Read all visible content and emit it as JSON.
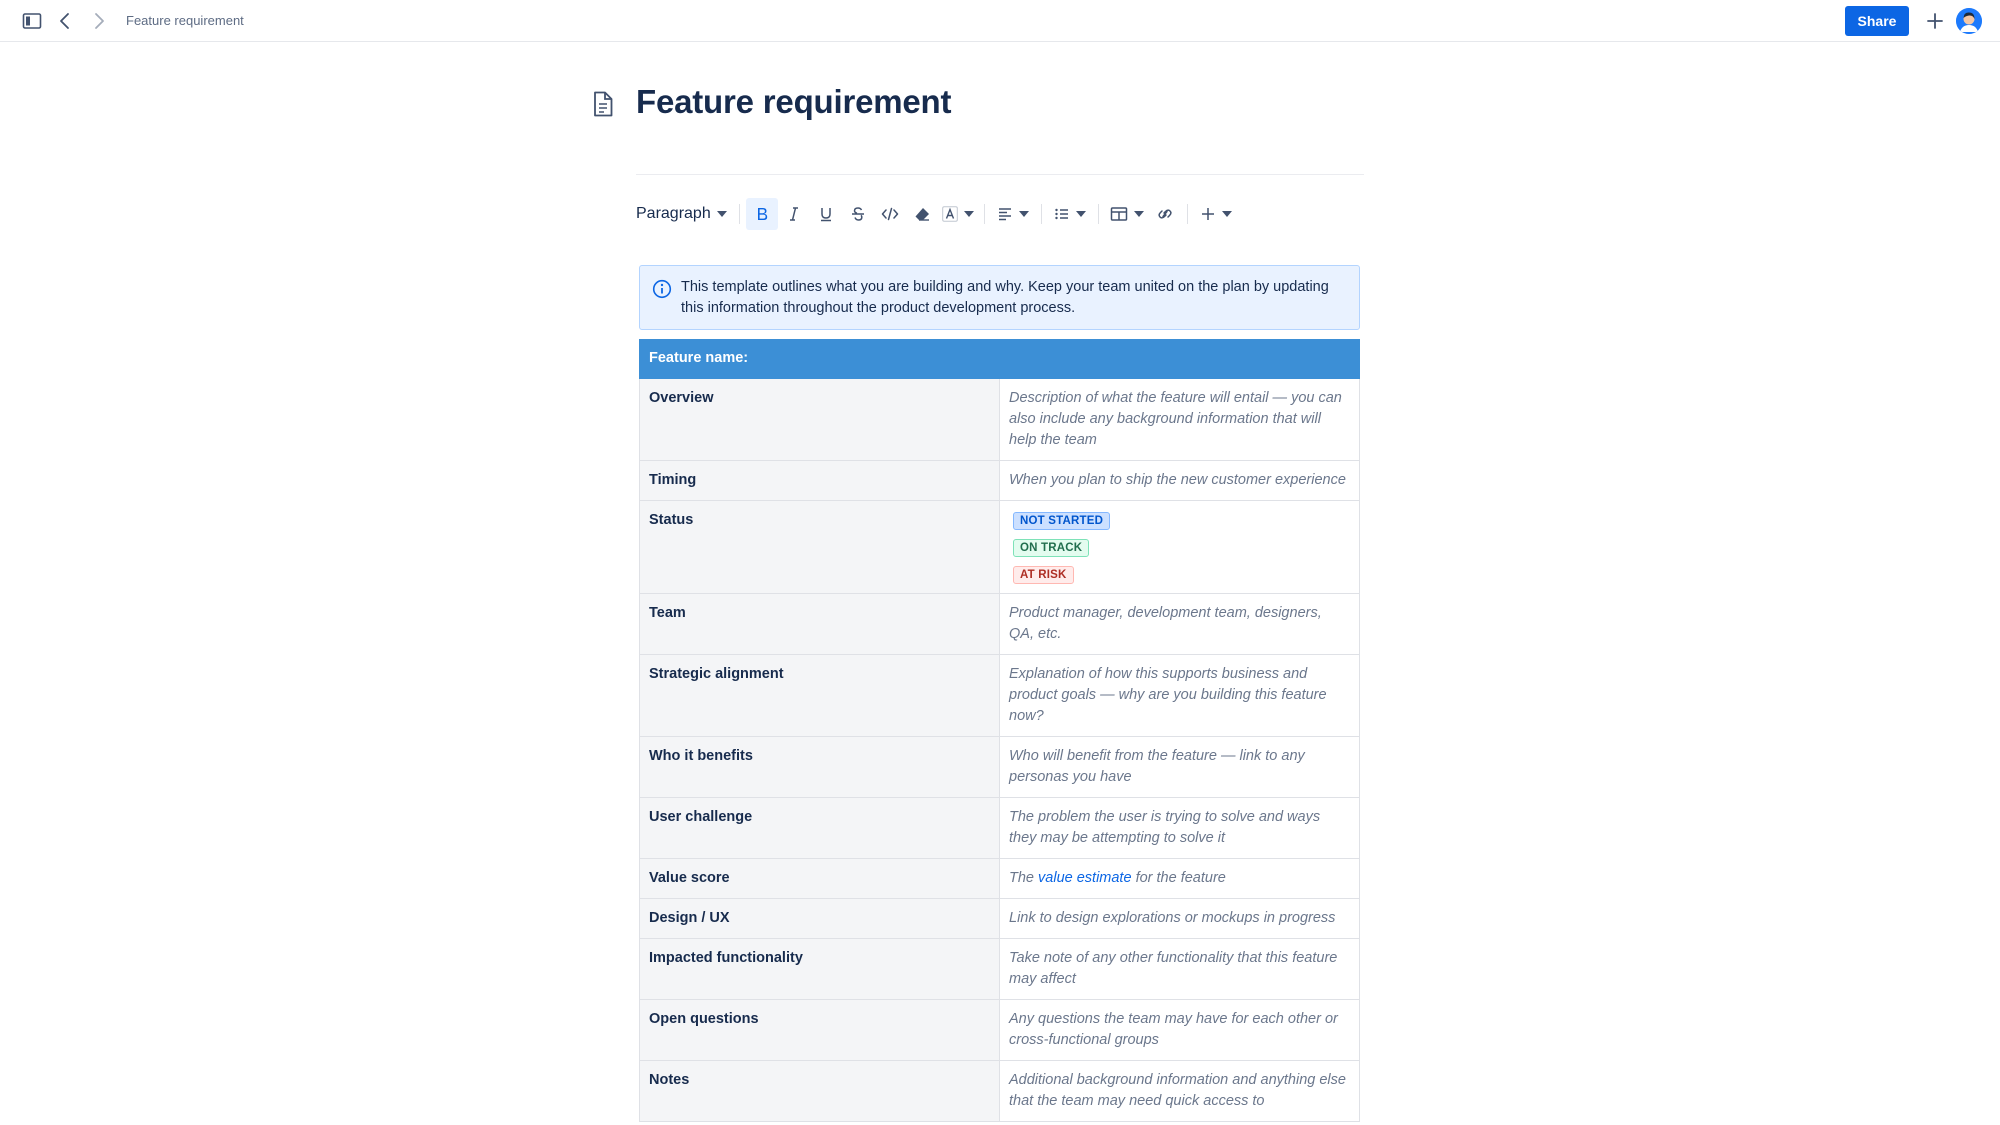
{
  "topbar": {
    "breadcrumb": "Feature requirement",
    "share_label": "Share"
  },
  "page": {
    "title": "Feature requirement"
  },
  "toolbar": {
    "paragraph_label": "Paragraph"
  },
  "info": {
    "text": "This template outlines what you are building and why. Keep your team united on the plan by updating this information throughout the product development process."
  },
  "table": {
    "header": "Feature name:",
    "rows": {
      "overview": {
        "label": "Overview",
        "value": "Description of what the feature will entail — you can also include any background information that will help the team"
      },
      "timing": {
        "label": "Timing",
        "value": "When you plan to ship the new customer experience"
      },
      "status": {
        "label": "Status",
        "badges": [
          "NOT STARTED",
          "ON TRACK",
          "AT RISK"
        ]
      },
      "team": {
        "label": "Team",
        "value": "Product manager, development team, designers, QA, etc."
      },
      "strategic": {
        "label": "Strategic alignment",
        "value": "Explanation of how this supports business and product goals — why are you building this feature now?"
      },
      "benefits": {
        "label": "Who it benefits",
        "value": "Who will benefit from the feature — link to any personas you have"
      },
      "challenge": {
        "label": "User challenge",
        "value": "The problem the user is trying to solve and ways they may be attempting to solve it"
      },
      "value_score": {
        "label": "Value score",
        "prefix": "The",
        "link": "value estimate",
        "suffix": "for the feature"
      },
      "design": {
        "label": "Design / UX",
        "value": "Link to design explorations or mockups in progress"
      },
      "impacted": {
        "label": "Impacted functionality",
        "value": "Take note of any other functionality that this feature may affect"
      },
      "questions": {
        "label": "Open questions",
        "value": "Any questions the team may have for each other or cross-functional groups"
      },
      "notes": {
        "label": "Notes",
        "value": "Additional background information and anything else that the team may need quick access to"
      }
    }
  },
  "colors": {
    "accent": "#0c66e4",
    "table_header": "#3c8fd6",
    "info_bg": "#e9f2ff"
  }
}
